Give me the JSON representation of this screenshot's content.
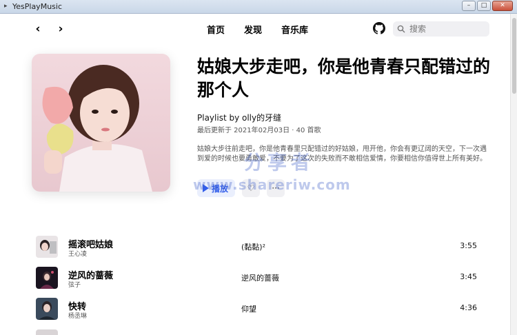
{
  "window": {
    "title": "YesPlayMusic",
    "buttons": [
      "–",
      "□",
      "✕"
    ]
  },
  "navbar": {
    "back_icon": "‹",
    "forward_icon": "›",
    "links": [
      "首页",
      "发现",
      "音乐库"
    ],
    "search_placeholder": "搜索"
  },
  "playlist": {
    "title": "姑娘大步走吧，你是他青春只配错过的那个人",
    "by": "Playlist by olly的牙缝",
    "meta": "最后更新于 2021年02月03日 · 40 首歌",
    "description": "姑娘大步往前走吧，你是他青春里只配错过的好姑娘，甩开他，你会有更辽阔的天空，下一次遇到爱的时候也要勇敢爱，不要为了这次的失败而不敢相信爱情，你要相信你值得世上所有美好。",
    "play_label": "播放",
    "like_icon": "♡",
    "more_icon": "···"
  },
  "watermark": {
    "main": "分享者",
    "url": "www.shareriw.com"
  },
  "tracks": [
    {
      "name": "摇滚吧姑娘",
      "artist": "王心凌",
      "album": "(黏黏)²",
      "duration": "3:55"
    },
    {
      "name": "逆风的蔷薇",
      "artist": "弦子",
      "album": "逆风的蔷薇",
      "duration": "3:45"
    },
    {
      "name": "快转",
      "artist": "杨丞琳",
      "album": "仰望",
      "duration": "4:36"
    }
  ],
  "colors": {
    "accent": "#335eea",
    "accent_bg": "#eaeffd"
  }
}
